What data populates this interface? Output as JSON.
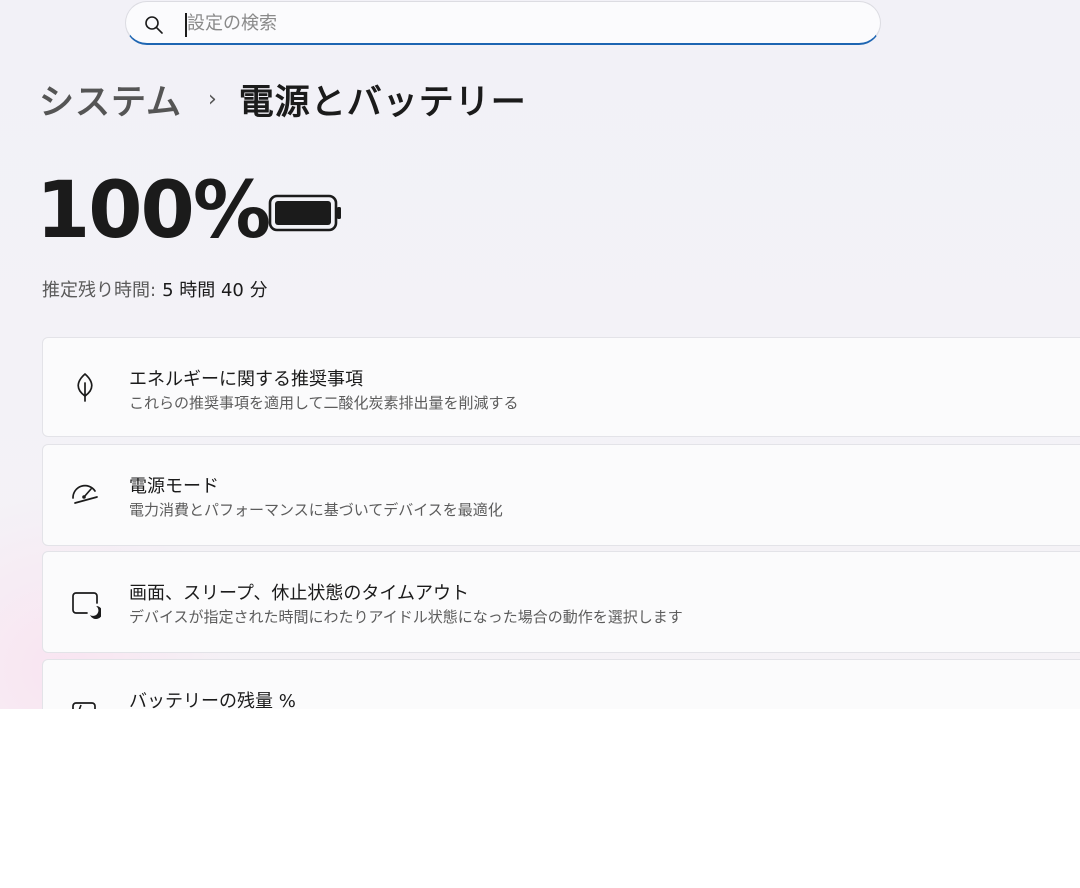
{
  "search": {
    "placeholder": "設定の検索"
  },
  "breadcrumb": {
    "parent": "システム",
    "separator": "›",
    "current": "電源とバッテリー"
  },
  "battery": {
    "percent_text": "100%",
    "level": 1.0,
    "remaining_label": "推定残り時間:",
    "remaining_value": "5 時間 40 分"
  },
  "settings": [
    {
      "title": "エネルギーに関する推奨事項",
      "desc": "これらの推奨事項を適用して二酸化炭素排出量を削減する",
      "icon": "leaf-icon"
    },
    {
      "title": "電源モード",
      "desc": "電力消費とパフォーマンスに基づいてデバイスを最適化",
      "icon": "gauge-icon"
    },
    {
      "title": "画面、スリープ、休止状態のタイムアウト",
      "desc": "デバイスが指定された時間にわたりアイドル状態になった場合の動作を選択します",
      "icon": "screen-sleep-icon"
    },
    {
      "title": "バッテリーの残量 %",
      "icon": "battery-saver-icon"
    }
  ],
  "colors": {
    "accent": "#1d65b2",
    "background": "#f2f1f7"
  }
}
